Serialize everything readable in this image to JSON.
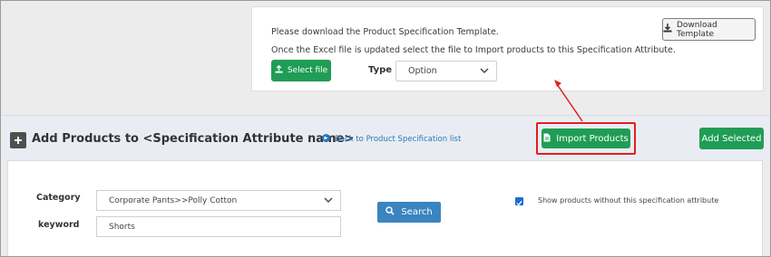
{
  "import_panel": {
    "line1": "Please download the Product Specification Template.",
    "line2": "Once the Excel file is updated select the file to Import products to this Specification Attribute.",
    "download_button": "Download Template",
    "select_file_button": "Select file",
    "type_label": "Type",
    "type_value": "Option"
  },
  "header": {
    "title": "Add Products to <Specification Attribute name>",
    "back_link": "Back to Product Specification list",
    "import_button": "Import Products",
    "add_selected_button": "Add Selected"
  },
  "search": {
    "category_label": "Category",
    "category_value": "Corporate Pants>>Polly Cotton",
    "keyword_label": "keyword",
    "keyword_value": "Shorts",
    "search_button": "Search",
    "checkbox_label": "Show products without this specification attribute",
    "checkbox_checked": true
  },
  "colors": {
    "primary_green": "#1f9d55",
    "search_blue": "#3a84bf",
    "annotation_red": "#e02020",
    "link_blue": "#2a79b8"
  },
  "icons": [
    "download-icon",
    "upload-icon",
    "chevron-down-icon",
    "plus-icon",
    "back-arrow-icon",
    "file-icon",
    "search-icon",
    "check-icon"
  ]
}
